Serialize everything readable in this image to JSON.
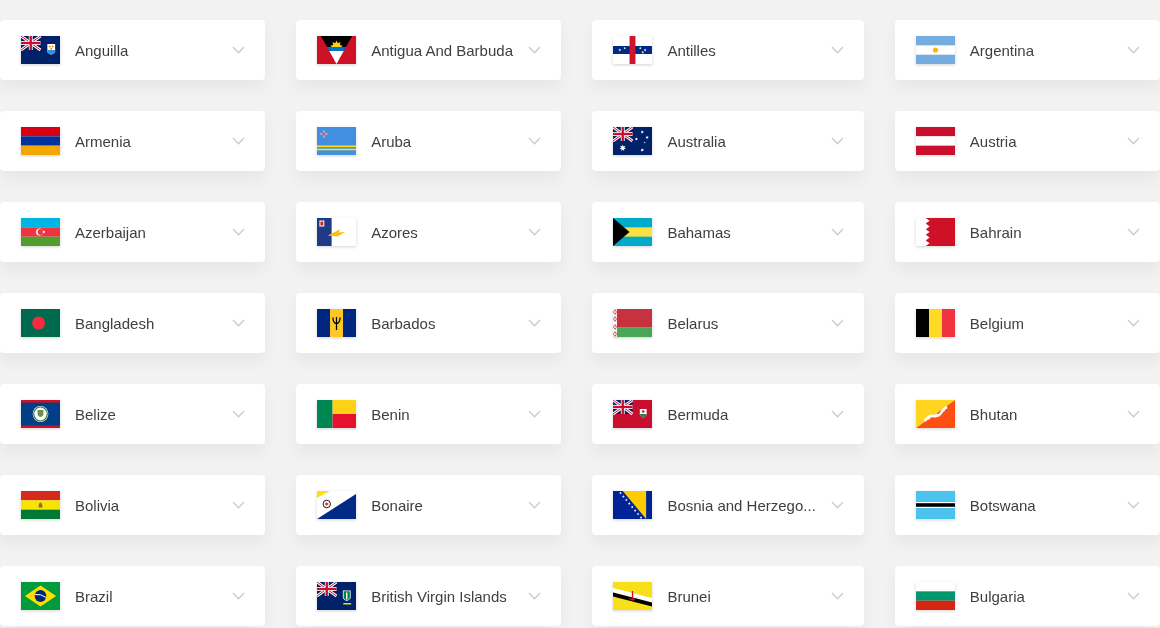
{
  "countries": [
    {
      "name": "Anguilla"
    },
    {
      "name": "Antigua And Barbuda"
    },
    {
      "name": "Antilles"
    },
    {
      "name": "Argentina"
    },
    {
      "name": "Armenia"
    },
    {
      "name": "Aruba"
    },
    {
      "name": "Australia"
    },
    {
      "name": "Austria"
    },
    {
      "name": "Azerbaijan"
    },
    {
      "name": "Azores"
    },
    {
      "name": "Bahamas"
    },
    {
      "name": "Bahrain"
    },
    {
      "name": "Bangladesh"
    },
    {
      "name": "Barbados"
    },
    {
      "name": "Belarus"
    },
    {
      "name": "Belgium"
    },
    {
      "name": "Belize"
    },
    {
      "name": "Benin"
    },
    {
      "name": "Bermuda"
    },
    {
      "name": "Bhutan"
    },
    {
      "name": "Bolivia"
    },
    {
      "name": "Bonaire"
    },
    {
      "name": "Bosnia and Herzego..."
    },
    {
      "name": "Botswana"
    },
    {
      "name": "Brazil"
    },
    {
      "name": "British Virgin Islands"
    },
    {
      "name": "Brunei"
    },
    {
      "name": "Bulgaria"
    }
  ]
}
